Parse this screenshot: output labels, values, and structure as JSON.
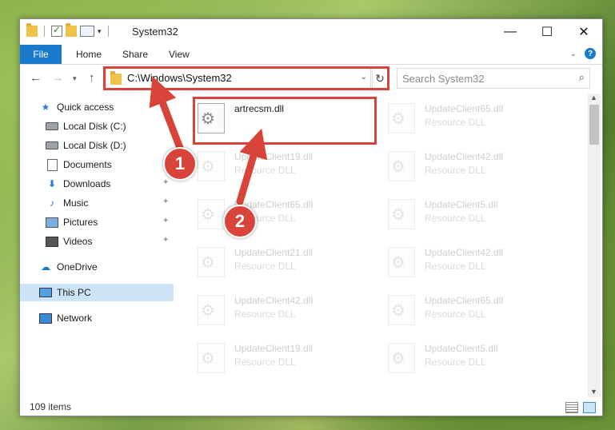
{
  "window": {
    "title": "System32",
    "minimize_glyph": "—",
    "maximize_glyph": "☐",
    "close_glyph": "✕"
  },
  "ribbon": {
    "tabs": [
      "File",
      "Home",
      "Share",
      "View"
    ],
    "help_label": "?"
  },
  "navbar": {
    "address": "C:\\Windows\\System32",
    "search_placeholder": "Search System32"
  },
  "sidebar": {
    "items": [
      {
        "label": "Quick access",
        "icon": "star-icon",
        "pinned": false
      },
      {
        "label": "Local Disk (C:)",
        "icon": "disk-icon",
        "pinned": false
      },
      {
        "label": "Local Disk (D:)",
        "icon": "disk-icon",
        "pinned": false
      },
      {
        "label": "Documents",
        "icon": "document-icon",
        "pinned": true
      },
      {
        "label": "Downloads",
        "icon": "download-icon",
        "pinned": true
      },
      {
        "label": "Music",
        "icon": "music-icon",
        "pinned": true
      },
      {
        "label": "Pictures",
        "icon": "pictures-icon",
        "pinned": true
      },
      {
        "label": "Videos",
        "icon": "videos-icon",
        "pinned": true
      },
      {
        "label": "OneDrive",
        "icon": "cloud-icon",
        "pinned": false
      },
      {
        "label": "This PC",
        "icon": "pc-icon",
        "pinned": false,
        "selected": true
      },
      {
        "label": "Network",
        "icon": "network-icon",
        "pinned": false
      }
    ]
  },
  "files": [
    {
      "name": "artrecsm.dll",
      "type": "",
      "highlighted": true
    },
    {
      "name": "UpdateClient65.dll",
      "type": "Resource DLL"
    },
    {
      "name": "UpdateClient19.dll",
      "type": "Resource DLL"
    },
    {
      "name": "UpdateClient42.dll",
      "type": "Resource DLL"
    },
    {
      "name": "UpdateClient65.dll",
      "type": "Resource DLL"
    },
    {
      "name": "UpdateClient5.dll",
      "type": "Resource DLL"
    },
    {
      "name": "UpdateClient21.dll",
      "type": "Resource DLL"
    },
    {
      "name": "UpdateClient42.dll",
      "type": "Resource DLL"
    },
    {
      "name": "UpdateClient42.dll",
      "type": "Resource DLL"
    },
    {
      "name": "UpdateClient65.dll",
      "type": "Resource DLL"
    },
    {
      "name": "UpdateClient19.dll",
      "type": "Resource DLL"
    },
    {
      "name": "UpdateClient5.dll",
      "type": "Resource DLL"
    }
  ],
  "status": {
    "item_count": "109 items"
  },
  "callouts": [
    {
      "label": "1"
    },
    {
      "label": "2"
    }
  ],
  "colors": {
    "accent": "#1979ca",
    "highlight": "#d9443a",
    "selection": "#cce4f7"
  }
}
